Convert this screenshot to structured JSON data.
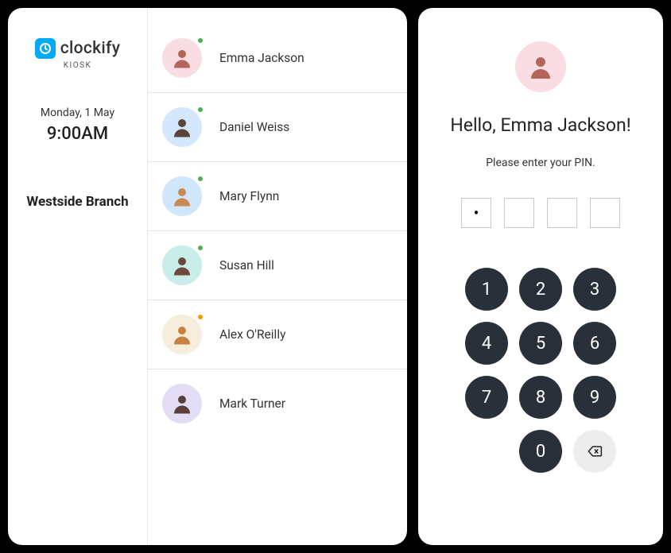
{
  "logo": {
    "text": "clockify",
    "sublabel": "KIOSK"
  },
  "date": "Monday, 1 May",
  "time": "9:00AM",
  "branch": "Westside Branch",
  "employees": [
    {
      "name": "Emma Jackson",
      "status": "green",
      "avatar_bg": "bg-pink"
    },
    {
      "name": "Daniel Weiss",
      "status": "green",
      "avatar_bg": "bg-blue"
    },
    {
      "name": "Mary Flynn",
      "status": "green",
      "avatar_bg": "bg-lblue"
    },
    {
      "name": "Susan Hill",
      "status": "green",
      "avatar_bg": "bg-teal"
    },
    {
      "name": "Alex O'Reilly",
      "status": "orange",
      "avatar_bg": "bg-cream"
    },
    {
      "name": "Mark Turner",
      "status": "none",
      "avatar_bg": "bg-lilac"
    }
  ],
  "pin_screen": {
    "greeting": "Hello, Emma Jackson!",
    "prompt": "Please enter your PIN.",
    "entered_digits": 1,
    "total_digits": 4,
    "selected_avatar_bg": "bg-pink"
  },
  "keypad": {
    "keys": [
      "1",
      "2",
      "3",
      "4",
      "5",
      "6",
      "7",
      "8",
      "9"
    ],
    "zero": "0"
  }
}
